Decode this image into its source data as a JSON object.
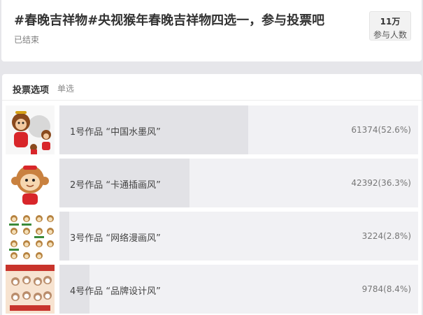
{
  "vote": {
    "title": "#春晚吉祥物#央视猴年春晚吉祥物四选一，参与投票吧",
    "status": "已结束",
    "participants_count": "11万",
    "participants_label": "参与人数"
  },
  "options_section": {
    "title": "投票选项",
    "type": "单选"
  },
  "options": [
    {
      "label": "1号作品 “中国水墨风”",
      "count": "61374(52.6%)",
      "percent": 52.6,
      "thumbnail_icon": "ink-wash-monkey-illustration"
    },
    {
      "label": "2号作品 “卡通插画风”",
      "count": "42392(36.3%)",
      "percent": 36.3,
      "thumbnail_icon": "cartoon-monkey-illustration"
    },
    {
      "label": "3号作品 “网络漫画风”",
      "count": "3224(2.8%)",
      "percent": 2.8,
      "thumbnail_icon": "comic-monkey-sprites"
    },
    {
      "label": "4号作品 “品牌设计风”",
      "count": "9784(8.4%)",
      "percent": 8.4,
      "thumbnail_icon": "brand-monkey-poster"
    }
  ],
  "colors": {
    "bar_background": "#f1f1f4",
    "bar_fill": "#e2e2e6",
    "page_background": "#e6e6ea"
  }
}
